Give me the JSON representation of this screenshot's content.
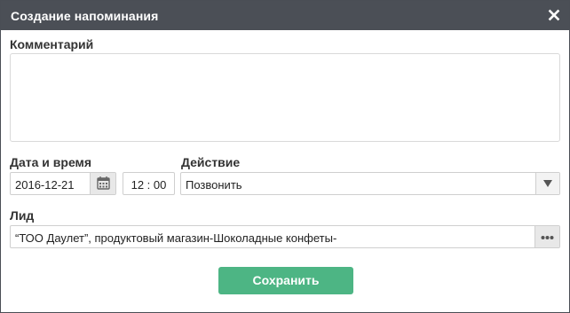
{
  "dialog": {
    "title": "Создание напоминания",
    "close_icon": "close-icon"
  },
  "comment": {
    "label": "Комментарий",
    "value": ""
  },
  "datetime": {
    "label": "Дата и время",
    "date_value": "2016-12-21",
    "time_value": "12 : 00",
    "calendar_icon": "calendar-icon"
  },
  "action": {
    "label": "Действие",
    "selected": "Позвонить",
    "arrow_icon": "triangle-down-icon"
  },
  "lead": {
    "label": "Лид",
    "value": "“ТОО Даулет”, продуктовый магазин-Шоколадные конфеты-",
    "more_icon": "ellipsis-icon"
  },
  "footer": {
    "save_label": "Сохранить"
  },
  "colors": {
    "titlebar": "#4b4f56",
    "save_button": "#4db584",
    "border": "#cfcfcf"
  }
}
